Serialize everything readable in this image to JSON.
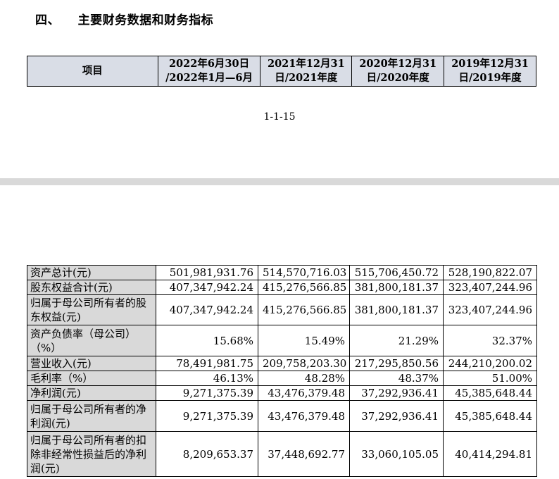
{
  "section": {
    "title": "四、    主要财务数据和财务指标"
  },
  "header": {
    "item": "项目",
    "columns": [
      {
        "line1": "2022年6月30日",
        "line2": "/2022年1月—6月"
      },
      {
        "line1": "2021年12月31",
        "line2": "日/2021年度"
      },
      {
        "line1": "2020年12月31",
        "line2": "日/2020年度"
      },
      {
        "line1": "2019年12月31",
        "line2": "日/2019年度"
      }
    ]
  },
  "page_number": "1-1-15",
  "rows": [
    {
      "label": "资产总计(元)",
      "values": [
        "501,981,931.76",
        "514,570,716.03",
        "515,706,450.72",
        "528,190,822.07"
      ]
    },
    {
      "label": "股东权益合计(元)",
      "values": [
        "407,347,942.24",
        "415,276,566.85",
        "381,800,181.37",
        "323,407,244.96"
      ]
    },
    {
      "label": "归属于母公司所有者的股东权益(元)",
      "values": [
        "407,347,942.24",
        "415,276,566.85",
        "381,800,181.37",
        "323,407,244.96"
      ]
    },
    {
      "label": "资产负债率（母公司）（%）",
      "values": [
        "15.68%",
        "15.49%",
        "21.29%",
        "32.37%"
      ]
    },
    {
      "label": "营业收入(元)",
      "values": [
        "78,491,981.75",
        "209,758,203.30",
        "217,295,850.56",
        "244,210,200.02"
      ]
    },
    {
      "label": "毛利率（%）",
      "values": [
        "46.13%",
        "48.28%",
        "48.37%",
        "51.00%"
      ]
    },
    {
      "label": "净利润(元)",
      "values": [
        "9,271,375.39",
        "43,476,379.48",
        "37,292,936.41",
        "45,385,648.44"
      ]
    },
    {
      "label": "归属于母公司所有者的净利润(元)",
      "values": [
        "9,271,375.39",
        "43,476,379.48",
        "37,292,936.41",
        "45,385,648.44"
      ]
    },
    {
      "label": "归属于母公司所有者的扣除非经常性损益后的净利润(元)",
      "values": [
        "8,209,653.37",
        "37,448,692.77",
        "33,060,105.05",
        "40,414,294.81"
      ]
    }
  ]
}
